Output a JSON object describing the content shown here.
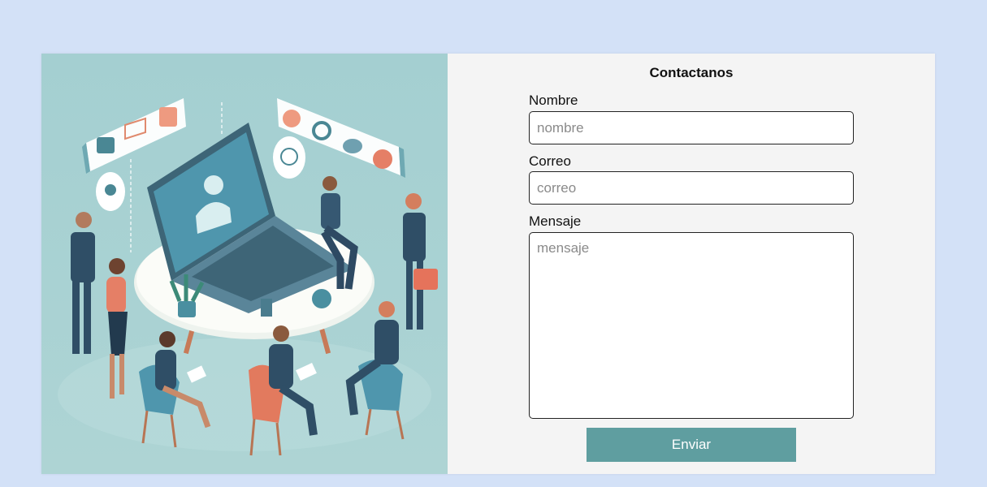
{
  "contact_form": {
    "title": "Contactanos",
    "name_label": "Nombre",
    "name_placeholder": "nombre",
    "name_value": "",
    "email_label": "Correo",
    "email_placeholder": "correo",
    "email_value": "",
    "message_label": "Mensaje",
    "message_placeholder": "mensaje",
    "message_value": "",
    "submit_label": "Enviar"
  },
  "colors": {
    "page_background": "#d3e1f7",
    "card_background": "#f4f4f4",
    "illustration_background": "#a9d2d3",
    "submit_button": "#5f9ea0"
  },
  "illustration": {
    "icons": [
      "chat-bubble-icon",
      "mail-icon",
      "calendar-icon",
      "headset-icon",
      "gear-icon",
      "fingerprint-icon",
      "cloud-icon",
      "pin-icon",
      "user-avatar-icon"
    ]
  }
}
